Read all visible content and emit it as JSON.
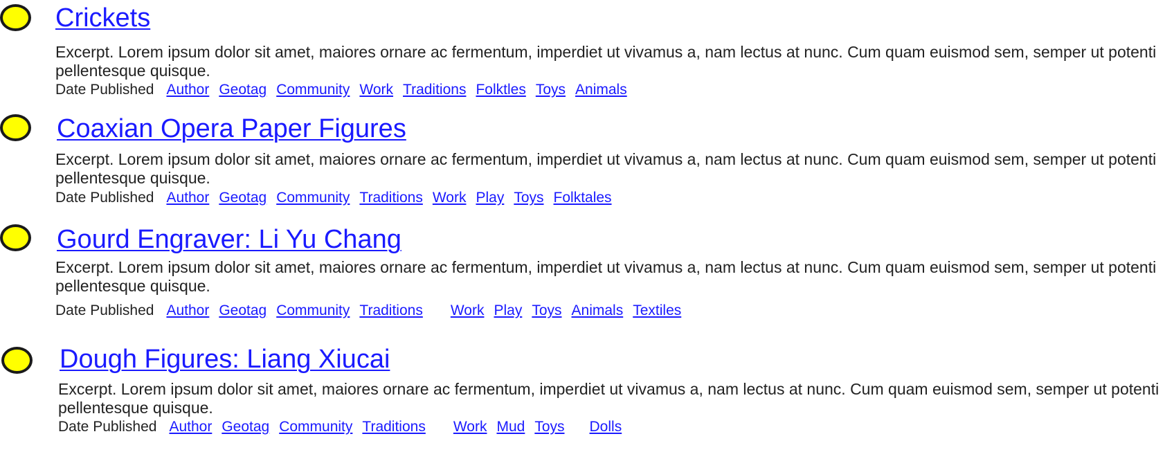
{
  "entries": [
    {
      "title": "Crickets",
      "excerpt": "Excerpt. Lorem ipsum dolor sit amet, maiores ornare ac fermentum, imperdiet ut vivamus a, nam lectus at nunc. Cum quam euismod sem, semper ut potenti pellentesque quisque.",
      "date_label": "Date Published",
      "tags": [
        "Author",
        "Geotag",
        "Community",
        "Work",
        "Traditions",
        "Folktles",
        "Toys",
        "Animals"
      ]
    },
    {
      "title": "Coaxian Opera Paper Figures",
      "excerpt": "Excerpt. Lorem ipsum dolor sit amet, maiores ornare ac fermentum, imperdiet ut vivamus a, nam lectus at nunc. Cum quam euismod sem, semper ut potenti pellentesque quisque.",
      "date_label": "Date Published",
      "tags": [
        "Author",
        "Geotag",
        "Community",
        "Traditions",
        "Work",
        "Play",
        "Toys",
        "Folktales"
      ]
    },
    {
      "title": "Gourd Engraver: Li Yu Chang",
      "excerpt": "Excerpt. Lorem ipsum dolor sit amet, maiores ornare ac fermentum, imperdiet ut vivamus a, nam lectus at nunc. Cum quam euismod sem, semper ut potenti pellentesque quisque.",
      "date_label": "Date Published",
      "tags": [
        "Author",
        "Geotag",
        "Community",
        "Traditions",
        "Work",
        "Play",
        "Toys",
        "Animals",
        "Textiles"
      ]
    },
    {
      "title": "Dough Figures: Liang Xiucai",
      "excerpt": "Excerpt. Lorem ipsum dolor sit amet, maiores ornare ac fermentum, imperdiet ut vivamus a, nam lectus at nunc. Cum quam euismod sem, semper ut potenti pellentesque quisque.",
      "date_label": "Date Published",
      "tags": [
        "Author",
        "Geotag",
        "Community",
        "Traditions",
        "Work",
        "Mud",
        "Toys",
        "Dolls"
      ]
    }
  ]
}
